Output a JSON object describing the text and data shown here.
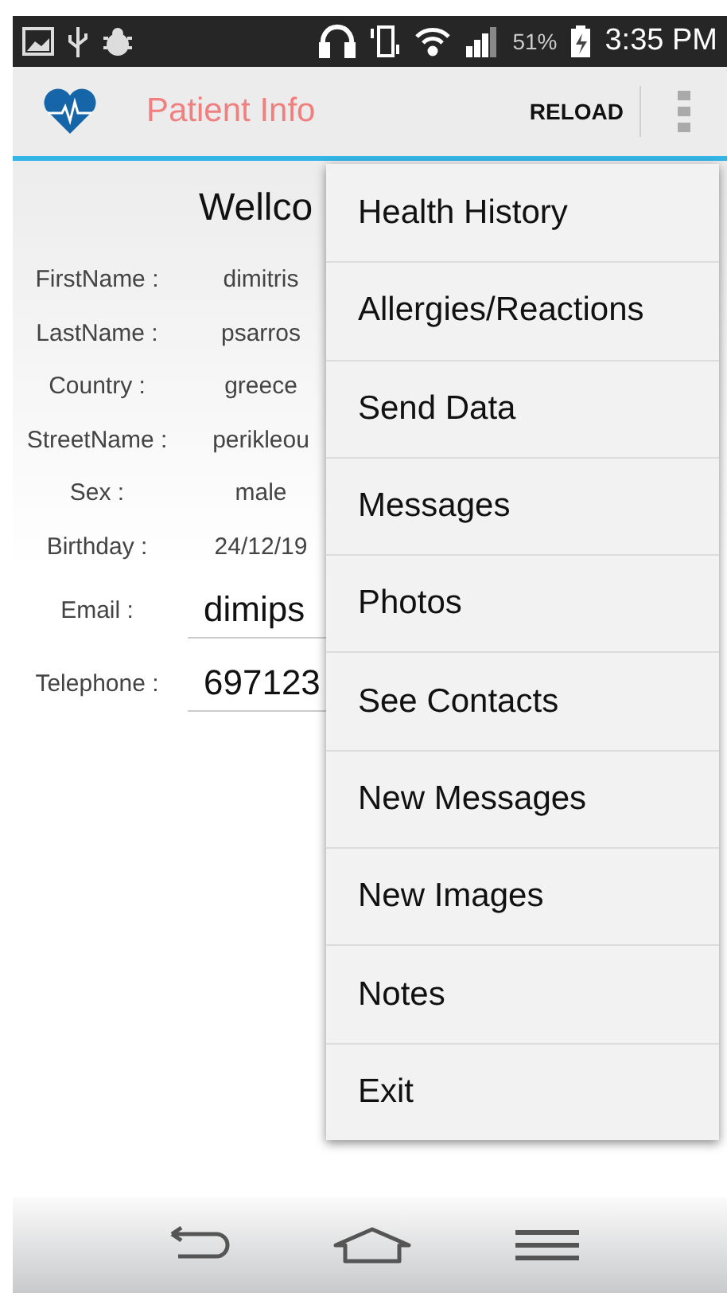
{
  "status_bar": {
    "battery": "51%",
    "time": "3:35 PM"
  },
  "app_bar": {
    "title": "Patient Info",
    "action": "RELOAD"
  },
  "heading": "Wellco",
  "fields": [
    {
      "kind": "text",
      "label": "FirstName :",
      "value": "dimitris"
    },
    {
      "kind": "text",
      "label": "LastName :",
      "value": "psarros"
    },
    {
      "kind": "text",
      "label": "Country :",
      "value": "greece"
    },
    {
      "kind": "text",
      "label": "StreetName :",
      "value": "perikleou"
    },
    {
      "kind": "text",
      "label": "Sex :",
      "value": "male"
    },
    {
      "kind": "text",
      "label": "Birthday :",
      "value": "24/12/19"
    },
    {
      "kind": "input",
      "label": "Email :",
      "value": "dimips"
    },
    {
      "kind": "input",
      "label": "Telephone :",
      "value": "697123"
    }
  ],
  "menu": {
    "items": [
      "Health History",
      "Allergies/Reactions",
      "Send Data",
      "Messages",
      "Photos",
      "See Contacts",
      "New Messages",
      "New Images",
      "Notes",
      "Exit"
    ]
  }
}
